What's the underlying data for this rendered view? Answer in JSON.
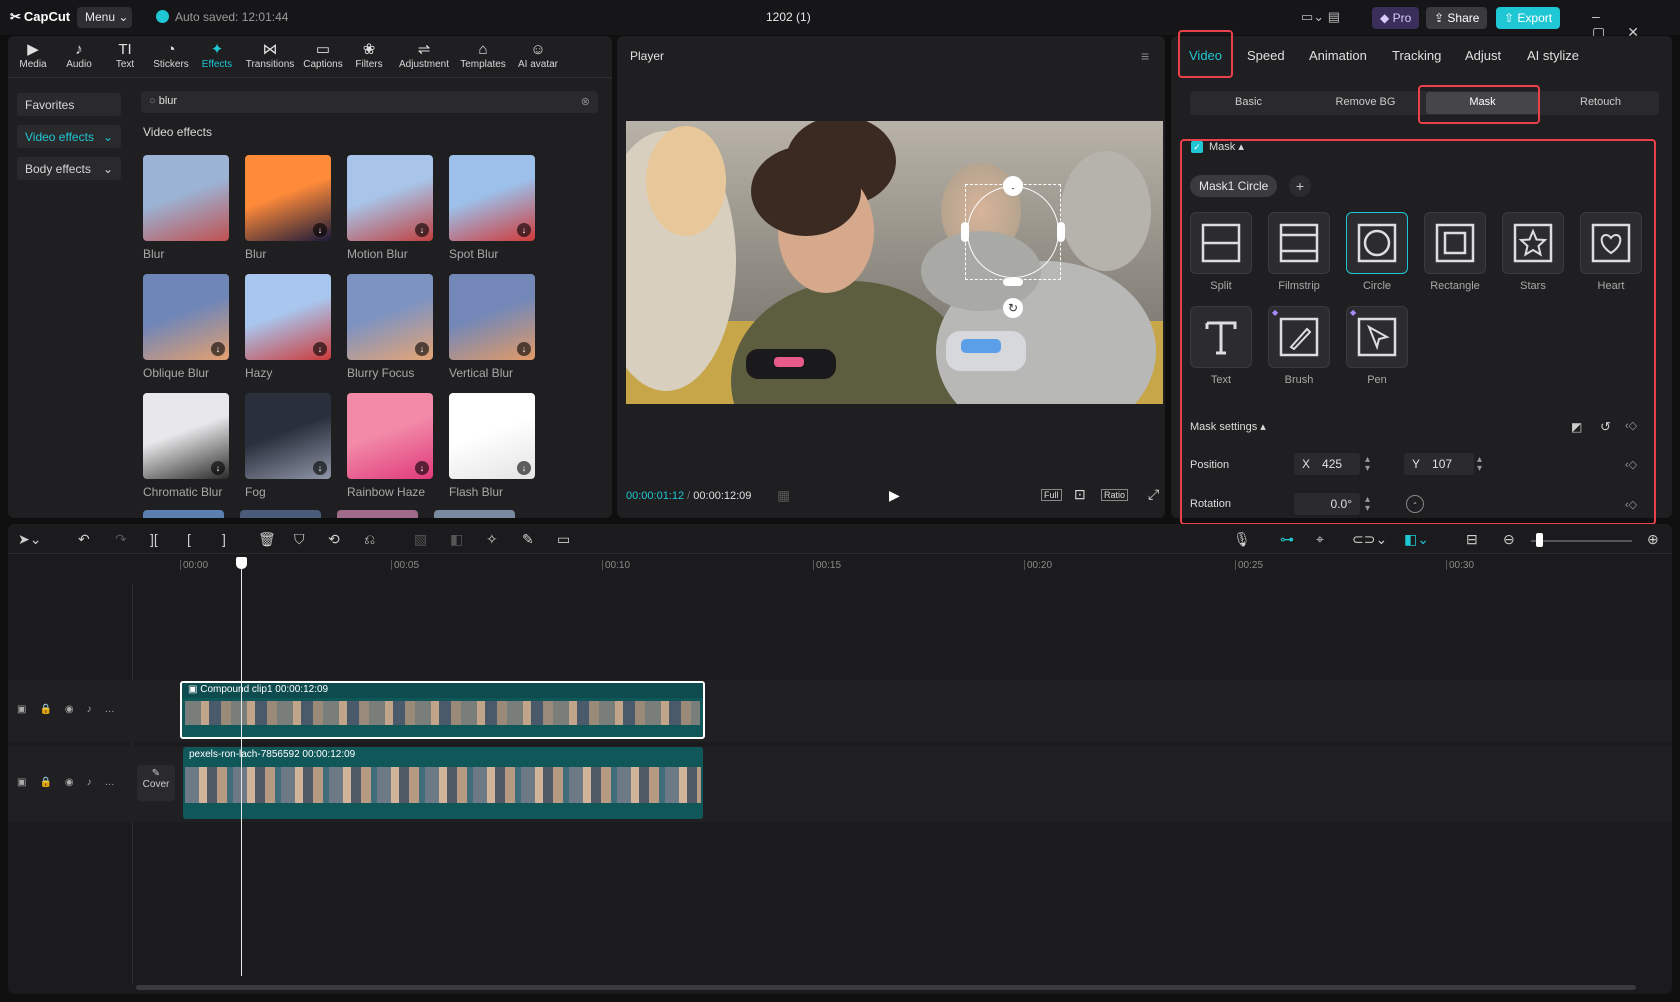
{
  "app": {
    "logo": "CapCut",
    "menu": "Menu",
    "autosave": "Auto saved: 12:01:44",
    "title": "1202 (1)",
    "pro": "Pro",
    "share": "Share",
    "export": "Export"
  },
  "toolbar": [
    {
      "icon": "media-icon",
      "glyph": "▶",
      "label": "Media"
    },
    {
      "icon": "audio-icon",
      "glyph": "♪",
      "label": "Audio"
    },
    {
      "icon": "text-icon",
      "glyph": "TI",
      "label": "Text"
    },
    {
      "icon": "stickers-icon",
      "glyph": "◔",
      "label": "Stickers"
    },
    {
      "icon": "effects-icon",
      "glyph": "✦",
      "label": "Effects"
    },
    {
      "icon": "transitions-icon",
      "glyph": "⋈",
      "label": "Transitions"
    },
    {
      "icon": "captions-icon",
      "glyph": "▭",
      "label": "Captions"
    },
    {
      "icon": "filters-icon",
      "glyph": "❀",
      "label": "Filters"
    },
    {
      "icon": "adjustment-icon",
      "glyph": "⇌",
      "label": "Adjustment"
    },
    {
      "icon": "templates-icon",
      "glyph": "⌂",
      "label": "Templates"
    },
    {
      "icon": "ai-avatar-icon",
      "glyph": "☺",
      "label": "AI avatar"
    }
  ],
  "sidebar": {
    "favorites": "Favorites",
    "video_effects": "Video effects",
    "body_effects": "Body effects"
  },
  "search": {
    "value": "blur"
  },
  "effects_heading": "Video effects",
  "effects": [
    {
      "label": "Blur",
      "c1": "#9bb4d6",
      "c2": "#c05050"
    },
    {
      "label": "Blur",
      "c1": "#ff8a3a",
      "c2": "#1a1a3a"
    },
    {
      "label": "Motion Blur",
      "c1": "#a8c4e8",
      "c2": "#c04040"
    },
    {
      "label": "Spot Blur",
      "c1": "#9cc0ea",
      "c2": "#d03a3a"
    },
    {
      "label": "Oblique Blur",
      "c1": "#6f86b8",
      "c2": "#e4a070"
    },
    {
      "label": "Hazy",
      "c1": "#a9c6ee",
      "c2": "#cc3a3a"
    },
    {
      "label": "Blurry Focus",
      "c1": "#7d93c2",
      "c2": "#e6a474"
    },
    {
      "label": "Vertical Blur",
      "c1": "#7388b8",
      "c2": "#e29a66"
    },
    {
      "label": "Chromatic Blur",
      "c1": "#e8e8ea",
      "c2": "#2a2a2a"
    },
    {
      "label": "Fog",
      "c1": "#2a2f3c",
      "c2": "#8f96a8"
    },
    {
      "label": "Rainbow Haze",
      "c1": "#f28aa8",
      "c2": "#e03a7a"
    },
    {
      "label": "Flash Blur",
      "c1": "#ffffff",
      "c2": "#e4e4e4"
    }
  ],
  "player": {
    "label": "Player",
    "current": "00:00:01:12",
    "total": "00:00:12:09",
    "full": "Full",
    "ratio": "Ratio"
  },
  "panel_tabs": [
    "Video",
    "Speed",
    "Animation",
    "Tracking",
    "Adjust",
    "AI stylize"
  ],
  "sub_tabs": [
    "Basic",
    "Remove BG",
    "Mask",
    "Retouch"
  ],
  "mask": {
    "label": "Mask",
    "chip": "Mask1 Circle",
    "shapes": [
      {
        "label": "Split",
        "icon": "split-mask-icon"
      },
      {
        "label": "Filmstrip",
        "icon": "filmstrip-mask-icon"
      },
      {
        "label": "Circle",
        "icon": "circle-mask-icon"
      },
      {
        "label": "Rectangle",
        "icon": "rectangle-mask-icon"
      },
      {
        "label": "Stars",
        "icon": "stars-mask-icon"
      },
      {
        "label": "Heart",
        "icon": "heart-mask-icon"
      },
      {
        "label": "Text",
        "icon": "text-mask-icon"
      },
      {
        "label": "Brush",
        "icon": "brush-mask-icon"
      },
      {
        "label": "Pen",
        "icon": "pen-mask-icon"
      }
    ],
    "settings": "Mask settings",
    "position": "Position",
    "x_label": "X",
    "x": "425",
    "y_label": "Y",
    "y": "107",
    "rotation": "Rotation",
    "rotation_value": "0.0°"
  },
  "ruler": [
    "00:00",
    "00:05",
    "00:10",
    "00:15",
    "00:20",
    "00:25",
    "00:30"
  ],
  "clips": {
    "compound": "Compound clip1",
    "compound_dur": "00:00:12:09",
    "main": "pexels-ron-lach-7856592",
    "main_dur": "00:00:12:09",
    "cover": "Cover"
  }
}
